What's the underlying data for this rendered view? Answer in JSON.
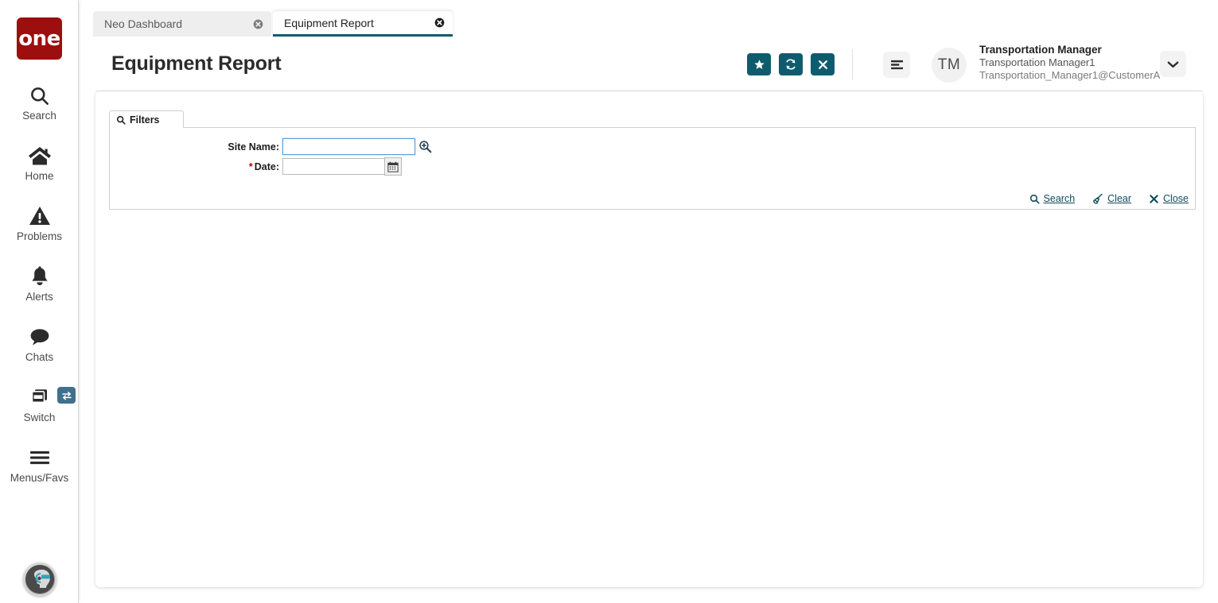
{
  "brand": {
    "logo_text": "one",
    "logo_color": "#9d0e0e",
    "accent_color": "#0d5c6e",
    "switch_badge_color": "#41708f"
  },
  "sidebar": {
    "items": [
      {
        "label": "Search",
        "icon": "search-icon"
      },
      {
        "label": "Home",
        "icon": "home-icon"
      },
      {
        "label": "Problems",
        "icon": "warning-triangle-icon"
      },
      {
        "label": "Alerts",
        "icon": "bell-icon"
      },
      {
        "label": "Chats",
        "icon": "chat-bubble-icon"
      },
      {
        "label": "Switch",
        "icon": "windows-stack-icon"
      },
      {
        "label": "Menus/Favs",
        "icon": "hamburger-icon"
      }
    ],
    "switch_badge_icon": "swap-arrows-icon",
    "assistant_icon": "ai-assistant-orb-icon"
  },
  "tabs": [
    {
      "label": "Neo Dashboard",
      "active": false,
      "close_icon": "close-circle-icon"
    },
    {
      "label": "Equipment Report",
      "active": true,
      "close_icon": "close-circle-icon"
    }
  ],
  "header": {
    "title": "Equipment Report",
    "actions": [
      {
        "name": "favorite-button",
        "icon": "star-icon",
        "label": "Favorite"
      },
      {
        "name": "refresh-button",
        "icon": "refresh-icon",
        "label": "Refresh"
      },
      {
        "name": "close-button",
        "icon": "x-icon",
        "label": "Close"
      }
    ],
    "menu_icon": "hamburger-menu-icon",
    "avatar_initials": "TM",
    "user_role": "Transportation Manager",
    "user_name": "Transportation Manager1",
    "user_email": "Transportation_Manager1@CustomerA",
    "chevron_icon": "chevron-down-icon"
  },
  "filters": {
    "tab_label": "Filters",
    "tab_icon": "search-icon",
    "fields": [
      {
        "label": "Site Name:",
        "required": false,
        "value": "",
        "placeholder": "",
        "focused": true,
        "adornment_icon": "magnifier-plus-icon"
      },
      {
        "label": "Date:",
        "required": true,
        "required_marker": "*",
        "value": "",
        "placeholder": "",
        "focused": false,
        "adornment_icon": "calendar-icon"
      }
    ],
    "actions": [
      {
        "label": "Search",
        "icon": "search-icon"
      },
      {
        "label": "Clear",
        "icon": "broom-icon"
      },
      {
        "label": "Close",
        "icon": "x-icon"
      }
    ]
  }
}
